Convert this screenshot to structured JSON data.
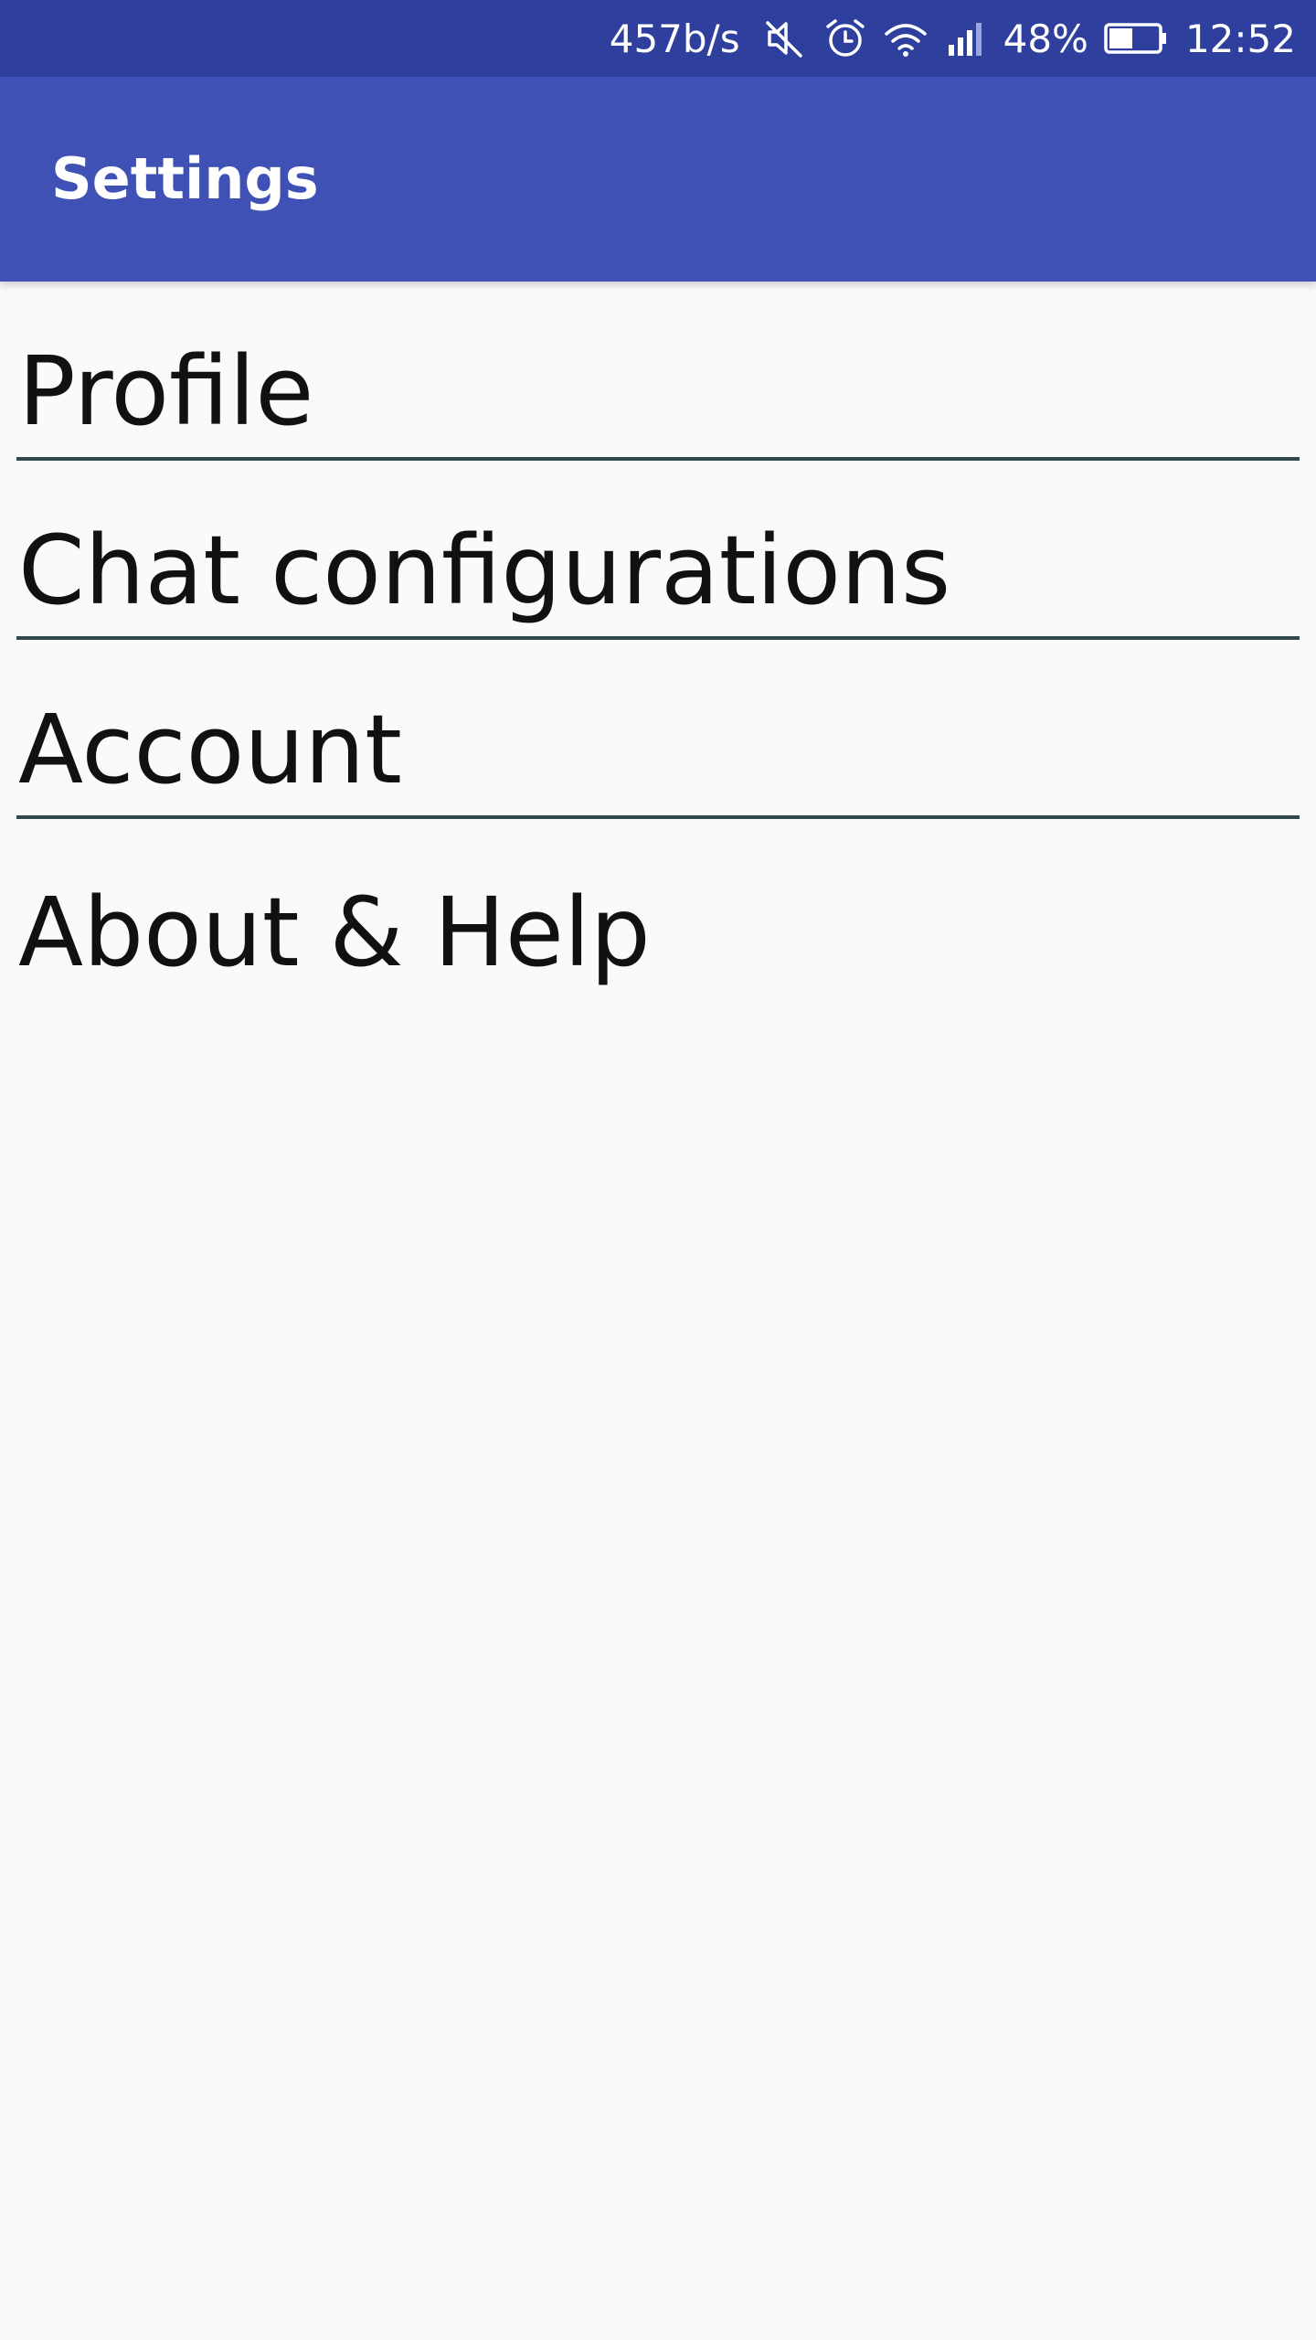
{
  "status_bar": {
    "net_speed": "457b/s",
    "battery_percent": "48%",
    "battery_level": 0.48,
    "time": "12:52",
    "icons": [
      "mute-icon",
      "alarm-icon",
      "wifi-icon",
      "signal-icon",
      "battery-icon"
    ]
  },
  "app_bar": {
    "title": "Settings",
    "color": "#3f51b5"
  },
  "menu": {
    "items": [
      {
        "label": "Profile"
      },
      {
        "label": "Chat configurations"
      },
      {
        "label": "Account"
      },
      {
        "label": "About & Help"
      }
    ]
  }
}
